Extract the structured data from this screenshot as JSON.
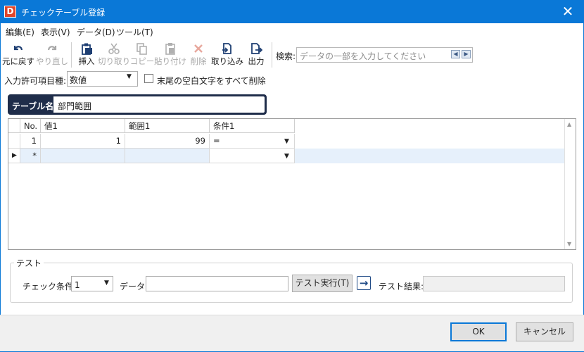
{
  "window": {
    "title": "チェックテーブル登録",
    "app_icon_letter": "D",
    "close_symbol": "✕"
  },
  "menu": [
    "編集(E)",
    "表示(V)",
    "データ(D)",
    "ツール(T)"
  ],
  "toolbar": {
    "undo": "元に戻す",
    "redo": "やり直し",
    "insert": "挿入",
    "cut": "切り取り",
    "copy": "コピー",
    "paste": "貼り付け",
    "delete": "削除",
    "import": "取り込み",
    "export": "出力",
    "search_label": "検索:",
    "search_placeholder": "データの一部を入力してください"
  },
  "options": {
    "type_label": "入力許可項目種:",
    "type_value": "数値",
    "trim_label": "末尾の空白文字をすべて削除",
    "trim_checked": false
  },
  "table_name": {
    "label": "テーブル名:",
    "value": "部門範囲"
  },
  "grid": {
    "columns": [
      "No.",
      "値1",
      "範囲1",
      "条件1"
    ],
    "rows": [
      {
        "no": "1",
        "value": "1",
        "range": "99",
        "condition": "="
      },
      {
        "no": "*",
        "value": "",
        "range": "",
        "condition": ""
      }
    ]
  },
  "test": {
    "title": "テスト",
    "condition_label": "チェック条件:",
    "condition_value": "1",
    "data_label": "データ:",
    "data_value": "",
    "run_button": "テスト実行(T)",
    "result_label": "テスト結果:",
    "result_value": ""
  },
  "footer": {
    "ok": "OK",
    "cancel": "キャンセル"
  },
  "colors": {
    "titlebar": "#0a78d7",
    "table_name_bg": "#1f2d4a",
    "new_row": "#e6f0fb"
  }
}
